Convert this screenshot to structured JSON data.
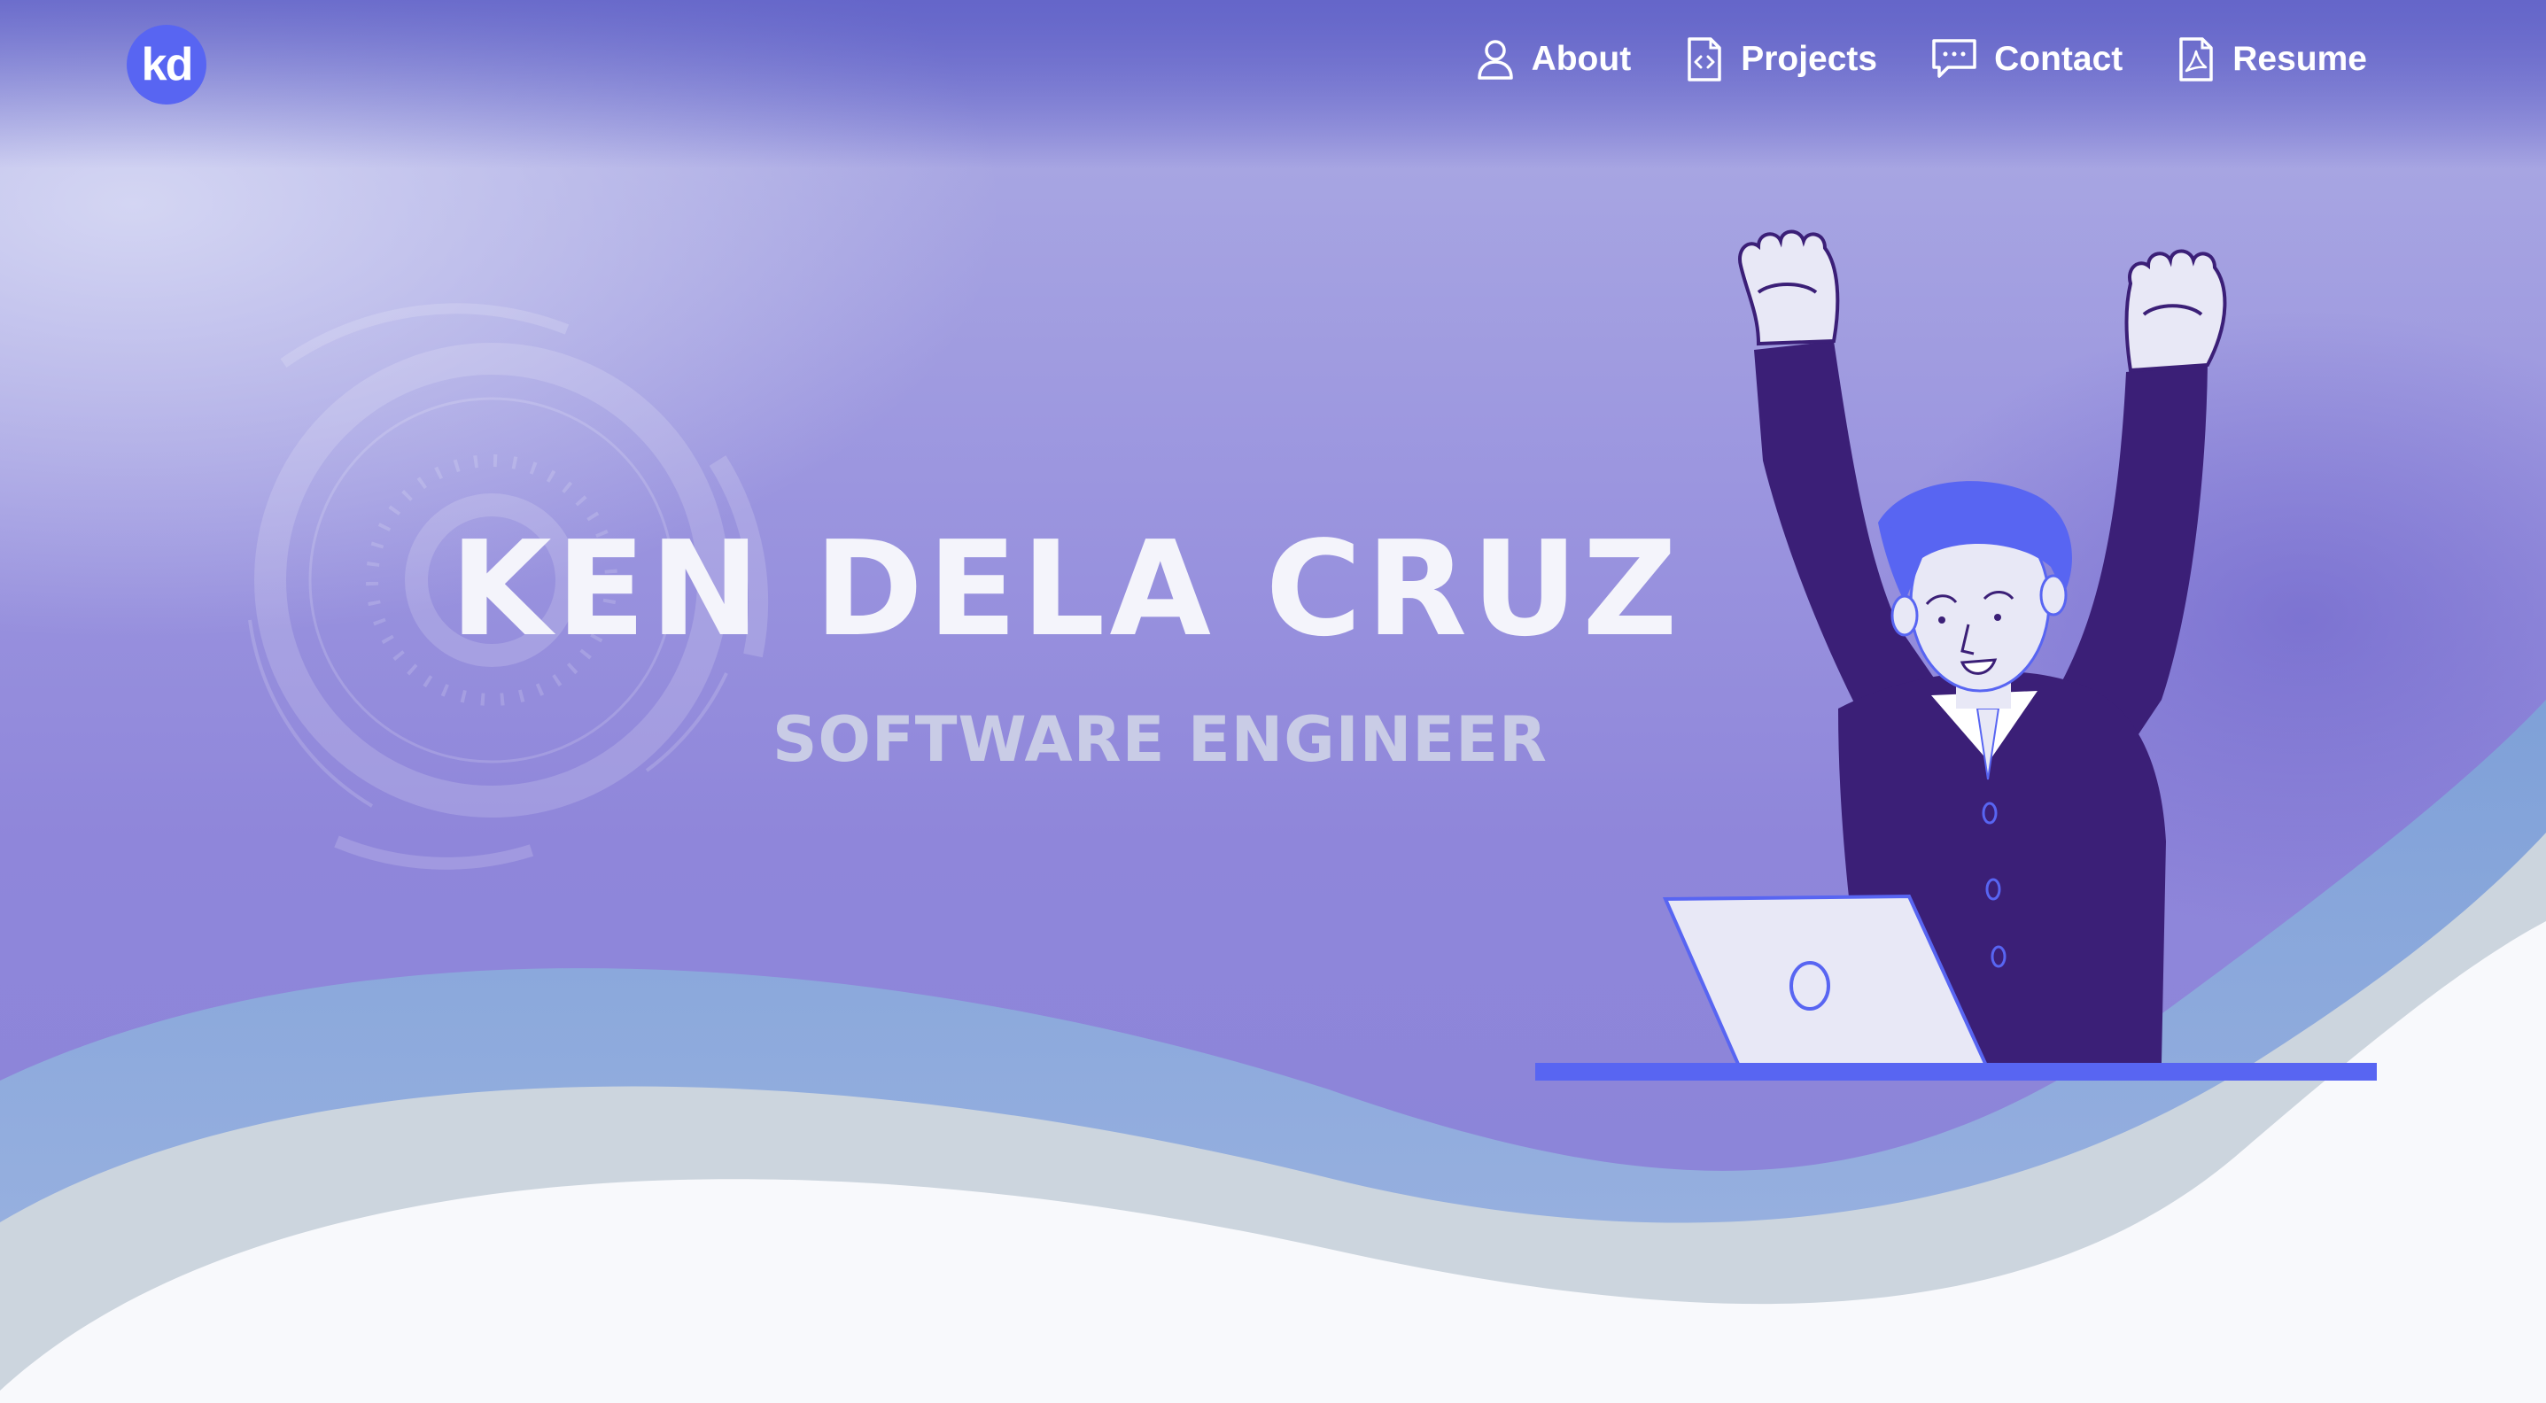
{
  "brand": {
    "logo_text": "kd"
  },
  "nav": {
    "items": [
      {
        "label": "About",
        "icon": "user-icon"
      },
      {
        "label": "Projects",
        "icon": "code-file-icon"
      },
      {
        "label": "Contact",
        "icon": "chat-bubble-icon"
      },
      {
        "label": "Resume",
        "icon": "pdf-file-icon"
      }
    ]
  },
  "hero": {
    "name": "KEN DELA CRUZ",
    "title": "SOFTWARE ENGINEER"
  },
  "colors": {
    "accent": "#5865f2",
    "suit": "#3b1f77",
    "wave_blue": "#7fa7d8",
    "wave_gray": "#c9d3de",
    "background": "#f8f9fc"
  }
}
